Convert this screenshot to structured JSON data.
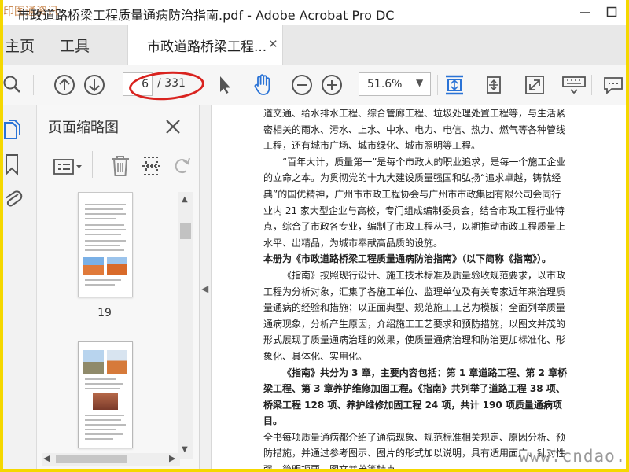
{
  "window": {
    "title": "市政道路桥梁工程质量通病防治指南.pdf - Adobe Acrobat Pro DC",
    "corner_watermark": "印图通资讯"
  },
  "tabs": {
    "home": "主页",
    "tools": "工具",
    "document": "市政道路桥梁工程..."
  },
  "toolbar": {
    "current_page": "6",
    "total_pages": "/ 331",
    "zoom": "51.6%"
  },
  "thumbnails": {
    "title": "页面缩略图",
    "pages": [
      {
        "number": "19"
      },
      {
        "number": ""
      }
    ]
  },
  "document": {
    "paragraphs": [
      {
        "indent": false,
        "bold": false,
        "text": "道交通、给水排水工程、综合管廊工程、垃圾处理处置工程等，与生活紧密相关的雨水、污水、上水、中水、电力、电信、热力、燃气等各种管线工程，还有城市广场、城市绿化、城市照明等工程。"
      },
      {
        "indent": true,
        "bold": false,
        "text": "“百年大计，质量第一”是每个市政人的职业追求，是每一个施工企业的立命之本。为贯彻党的十九大建设质量强国和弘扬“追求卓越，铸就经典”的国优精神，广州市市政工程协会与广州市市政集团有限公司会同行业内 21 家大型企业与高校，专门组成编制委员会，结合市政工程行业特点，综合了市政各专业，编制了市政工程丛书，以期推动市政工程质量上水平、出精品，为城市奉献高品质的设施。"
      },
      {
        "indent": false,
        "bold": true,
        "text": "本册为《市政道路桥梁工程质量通病防治指南》（以下简称《指南》）。"
      },
      {
        "indent": true,
        "bold": false,
        "text": "《指南》按照现行设计、施工技术标准及质量验收规范要求，以市政工程为分析对象，汇集了各施工单位、监理单位及有关专家近年来治理质量通病的经验和措施；以正面典型、规范施工工艺为模板；全面列举质量通病现象，分析产生原因，介绍施工工艺要求和预防措施，以图文并茂的形式展现了质量通病治理的效果，使质量通病治理和防治更加标准化、形象化、具体化、实用化。"
      },
      {
        "indent": true,
        "bold": true,
        "text": "《指南》共分为 3 章，主要内容包括：第 1 章道路工程、第 2 章桥梁工程、第 3 章养护维修加固工程。《指南》共列举了道路工程 38 项、桥梁工程 128 项、养护维修加固工程 24 项，共计 190 项质量通病项目。"
      },
      {
        "indent": false,
        "bold": false,
        "text": "全书每项质量通病都介绍了通病现象、规范标准相关规定、原因分析、预防措施，并通过参考图示、图片的形式加以说明，具有适用面广、针对性强、简明扼要、图文并茂等特点。"
      }
    ],
    "bottom_watermark": "www.cndao.com"
  },
  "colors": {
    "frame_border": "#f5d800",
    "annotation_oval": "#d9231f",
    "hand_tool_active": "#2a73d6",
    "icon_gray": "#555555"
  }
}
